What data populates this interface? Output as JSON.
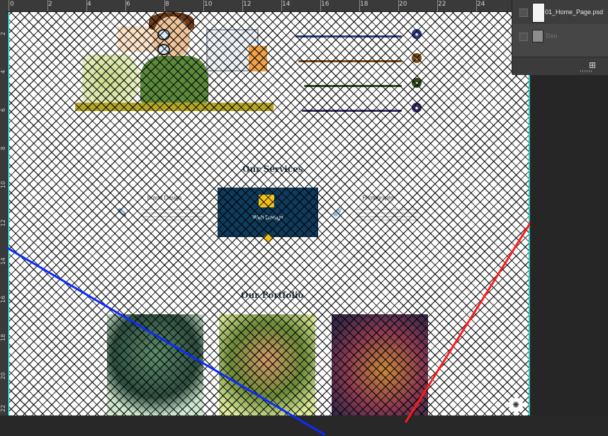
{
  "ruler": {
    "top_numbers": [
      "0",
      "2",
      "4",
      "6",
      "8",
      "10",
      "12",
      "14",
      "16",
      "18",
      "20",
      "22",
      "24"
    ],
    "left_numbers": [
      "2",
      "4",
      "6",
      "8",
      "10",
      "12",
      "14",
      "16",
      "18",
      "20",
      "22"
    ]
  },
  "layers": {
    "items": [
      {
        "name": "01_Home_Page.psd",
        "selected": true
      },
      {
        "name": "Trim",
        "selected": false
      }
    ],
    "new_icon": "new-layer-icon"
  },
  "hero": {
    "skills": [
      {
        "color": "#2b3f86",
        "icon": "ps-icon"
      },
      {
        "color": "#7a4a12",
        "icon": "ai-icon"
      },
      {
        "color": "#2f4a18",
        "icon": "dw-icon"
      },
      {
        "color": "#3d2f6b",
        "icon": "fl-icon"
      }
    ]
  },
  "services": {
    "title": "Our Services",
    "items": [
      {
        "label": "Brand Design",
        "icon": "pen-icon"
      },
      {
        "label": "Web Design",
        "icon": "folder-icon",
        "active": true
      },
      {
        "label": "Photography",
        "icon": "pencil-icon"
      }
    ]
  },
  "portfolio": {
    "title": "Our Portfolio"
  },
  "colors": {
    "guide": "#27c6b8",
    "active_service": "#0f3b5c",
    "accent": "#f2c21b",
    "blue_line": "#0b2bff",
    "red_line": "#ff1a1a"
  }
}
